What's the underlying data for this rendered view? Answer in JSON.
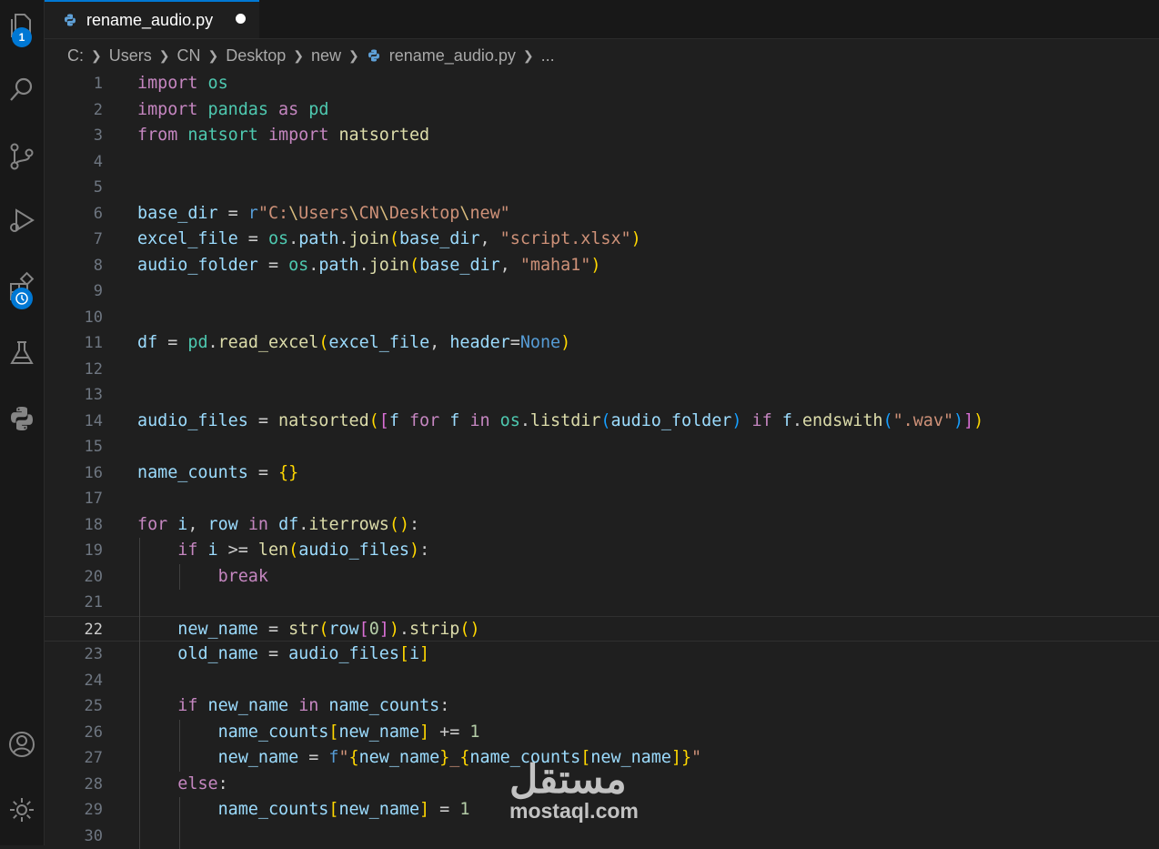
{
  "tab": {
    "filename": "rename_audio.py",
    "dirty": true
  },
  "breadcrumb": {
    "items": [
      "C:",
      "Users",
      "CN",
      "Desktop",
      "new",
      "rename_audio.py",
      "..."
    ]
  },
  "activity_bar": {
    "explorer_badge": "1",
    "icons": [
      "files-icon",
      "search-icon",
      "source-control-icon",
      "run-debug-icon",
      "extensions-icon",
      "testing-icon",
      "python-icon",
      "account-icon",
      "settings-gear-icon"
    ]
  },
  "editor": {
    "current_line": 22,
    "lines": [
      {
        "n": "1",
        "text": "import os"
      },
      {
        "n": "2",
        "text": "import pandas as pd"
      },
      {
        "n": "3",
        "text": "from natsort import natsorted"
      },
      {
        "n": "4",
        "text": ""
      },
      {
        "n": "5",
        "text": ""
      },
      {
        "n": "6",
        "text": "base_dir = r\"C:\\Users\\CN\\Desktop\\new\""
      },
      {
        "n": "7",
        "text": "excel_file = os.path.join(base_dir, \"script.xlsx\")"
      },
      {
        "n": "8",
        "text": "audio_folder = os.path.join(base_dir, \"maha1\")"
      },
      {
        "n": "9",
        "text": ""
      },
      {
        "n": "10",
        "text": ""
      },
      {
        "n": "11",
        "text": "df = pd.read_excel(excel_file, header=None)"
      },
      {
        "n": "12",
        "text": ""
      },
      {
        "n": "13",
        "text": ""
      },
      {
        "n": "14",
        "text": "audio_files = natsorted([f for f in os.listdir(audio_folder) if f.endswith(\".wav\")])"
      },
      {
        "n": "15",
        "text": ""
      },
      {
        "n": "16",
        "text": "name_counts = {}"
      },
      {
        "n": "17",
        "text": ""
      },
      {
        "n": "18",
        "text": "for i, row in df.iterrows():"
      },
      {
        "n": "19",
        "text": "    if i >= len(audio_files):"
      },
      {
        "n": "20",
        "text": "        break"
      },
      {
        "n": "21",
        "text": ""
      },
      {
        "n": "22",
        "text": "    new_name = str(row[0]).strip()"
      },
      {
        "n": "23",
        "text": "    old_name = audio_files[i]"
      },
      {
        "n": "24",
        "text": ""
      },
      {
        "n": "25",
        "text": "    if new_name in name_counts:"
      },
      {
        "n": "26",
        "text": "        name_counts[new_name] += 1"
      },
      {
        "n": "27",
        "text": "        new_name = f\"{new_name}_{name_counts[new_name]}\""
      },
      {
        "n": "28",
        "text": "    else:"
      },
      {
        "n": "29",
        "text": "        name_counts[new_name] = 1"
      },
      {
        "n": "30",
        "text": ""
      }
    ]
  },
  "watermark": {
    "logo": "مستقل",
    "text": "mostaql.com"
  },
  "colors": {
    "accent": "#0078d4",
    "background": "#1f1f1f",
    "keyword": "#c586c0",
    "string": "#ce9178",
    "function": "#dcdcaa",
    "variable": "#9cdcfe"
  }
}
